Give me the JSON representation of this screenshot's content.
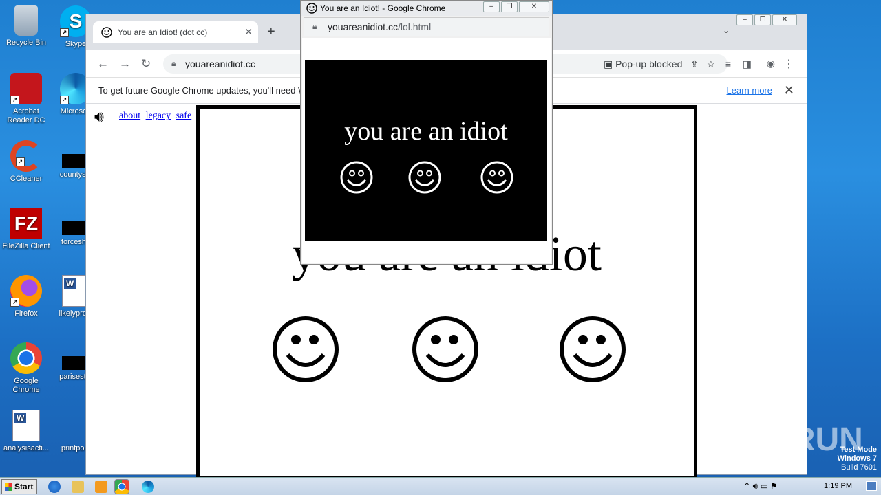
{
  "desktop": {
    "icons_left": [
      {
        "label": "Recycle Bin"
      },
      {
        "label": "Acrobat Reader DC"
      },
      {
        "label": "CCleaner"
      },
      {
        "label": "FileZilla Client"
      },
      {
        "label": "Firefox"
      },
      {
        "label": "Google Chrome"
      },
      {
        "label": "analysisacti..."
      }
    ],
    "icons_right": [
      {
        "label": "Skype"
      },
      {
        "label": "Microsoft"
      },
      {
        "label": "countystc"
      },
      {
        "label": "forceshe"
      },
      {
        "label": "likelyproje"
      },
      {
        "label": "parisest..."
      },
      {
        "label": "printpool"
      }
    ]
  },
  "main_window": {
    "tab_title": "You are an Idiot! (dot cc)",
    "url": "youareanidiot.cc",
    "popup_blocked": "Pop-up blocked",
    "infobar_text": "To get future Google Chrome updates, you'll need W",
    "learn_more": "Learn more",
    "page_links": [
      "about",
      "legacy",
      "safe"
    ],
    "big_text": "you are an idiot"
  },
  "popup_window": {
    "title": "You are an Idiot! - Google Chrome",
    "url_host": "youareanidiot.cc",
    "url_path": "/lol.html",
    "text": "you are an idiot"
  },
  "taskbar": {
    "start_label": "Start",
    "clock": "1:19 PM"
  },
  "watermark": {
    "line1": "Test Mode",
    "line2": "Windows 7",
    "line3": "Build 7601",
    "brand": "ANY RUN"
  }
}
